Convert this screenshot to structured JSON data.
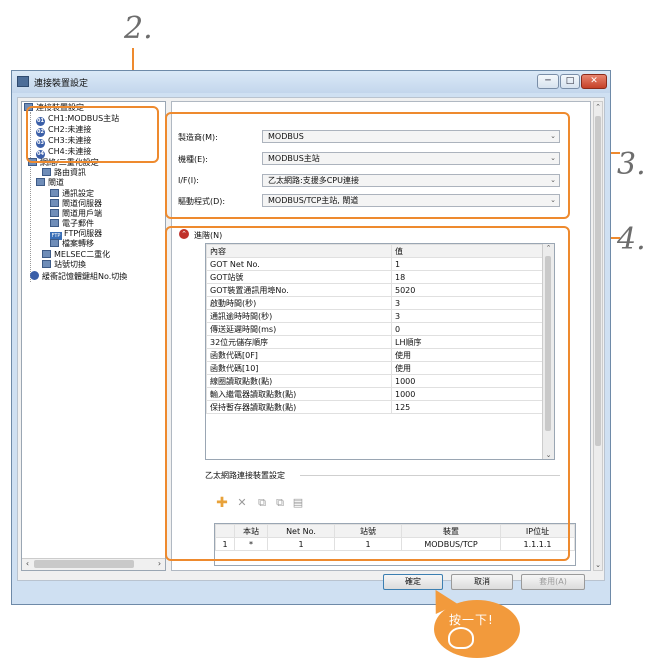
{
  "callouts": {
    "c2": "2.",
    "c3": "3.",
    "c4": "4."
  },
  "window": {
    "title": "連接裝置設定",
    "controls": {
      "minimize": "─",
      "maximize": "□",
      "close": "✕"
    }
  },
  "tree": {
    "root": "連接裝置設定",
    "channels": [
      {
        "badge": "01",
        "label": "CH1:MODBUS主站"
      },
      {
        "badge": "02",
        "label": "CH2:未連接"
      },
      {
        "badge": "03",
        "label": "CH3:未連接"
      },
      {
        "badge": "04",
        "label": "CH4:未連接"
      }
    ],
    "network": "網絡/二重化設定",
    "routing": "路由資訊",
    "gateway": "閘道",
    "comm": "通訊設定",
    "gw_server": "閘道伺服器",
    "gw_client": "閘道用戶端",
    "email": "電子郵件",
    "ftp_badge": "FTP",
    "ftp": "FTP伺服器",
    "file_transfer": "檔案轉移",
    "melsec": "MELSEC二重化",
    "station_switch": "站號切換",
    "buffer_memory": "緩衝記憶體鍵組No.切換"
  },
  "form": {
    "manufacturer_label": "製造商(M):",
    "manufacturer_value": "MODBUS",
    "model_label": "機種(E):",
    "model_value": "MODBUS主站",
    "if_label": "I/F(I):",
    "if_value": "乙太網路:支援多CPU連接",
    "driver_label": "驅動程式(D):",
    "driver_value": "MODBUS/TCP主站, 閘道"
  },
  "advanced": {
    "label": "進階(N)",
    "col_content": "內容",
    "col_value": "值",
    "rows": [
      [
        "GOT Net No.",
        "1"
      ],
      [
        "GOT站號",
        "18"
      ],
      [
        "GOT裝置通訊用埠No.",
        "5020"
      ],
      [
        "啟動時間(秒)",
        "3"
      ],
      [
        "通訊逾時時間(秒)",
        "3"
      ],
      [
        "傳送延遲時間(ms)",
        "0"
      ],
      [
        "32位元儲存順序",
        "LH順序"
      ],
      [
        "函數代碼[0F]",
        "使用"
      ],
      [
        "函數代碼[10]",
        "使用"
      ],
      [
        "線圈讀取點數(點)",
        "1000"
      ],
      [
        "輸入繼電器讀取點數(點)",
        "1000"
      ],
      [
        "保持暫存器讀取點數(點)",
        "125"
      ]
    ]
  },
  "device_section": {
    "title": "乙太網路連接裝置設定",
    "headers": [
      "本站",
      "Net No.",
      "站號",
      "裝置",
      "IP位址"
    ],
    "rows": [
      [
        "1",
        "*",
        "1",
        "1",
        "MODBUS/TCP",
        "1.1.1.1"
      ]
    ]
  },
  "buttons": {
    "ok": "確定",
    "cancel": "取消",
    "apply": "套用(A)"
  },
  "hint": "按一下!",
  "colors": {
    "callout": "#ee8a2e",
    "accent": "#3b5fa8"
  }
}
